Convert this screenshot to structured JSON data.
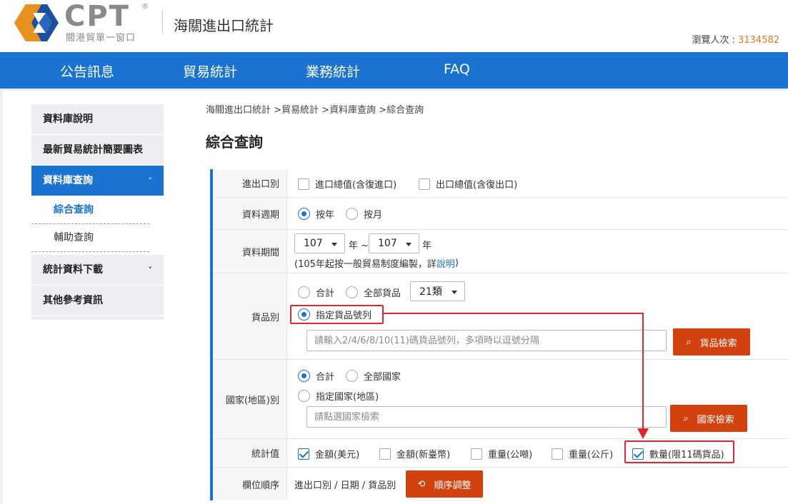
{
  "header": {
    "logo_text": "CPT",
    "logo_reg": "®",
    "logo_subtitle": "關港貿單一窗口",
    "site_title": "海關進出口統計",
    "visitor_label": "瀏覽人次 : ",
    "visitor_count": "3134582"
  },
  "nav": {
    "items": [
      "公告訊息",
      "貿易統計",
      "業務統計",
      "FAQ"
    ]
  },
  "sidebar": {
    "items": [
      {
        "label": "資料庫說明"
      },
      {
        "label": "最新貿易統計簡要圖表"
      },
      {
        "label": "資料庫查詢",
        "chevron": "˄"
      },
      {
        "label": "統計資料下載",
        "chevron": "˅"
      },
      {
        "label": "其他參考資訊"
      }
    ],
    "subitems": [
      "綜合查詢",
      "輔助查詢"
    ]
  },
  "breadcrumb": "海關進出口統計 >貿易統計 >資料庫查詢 >綜合查詢",
  "page_title": "綜合查詢",
  "form": {
    "import_export": {
      "label": "進出口別",
      "options": [
        "進口總值(含復進口)",
        "出口總值(含復出口)"
      ]
    },
    "period_type": {
      "label": "資料週期",
      "options": [
        "按年",
        "按月"
      ]
    },
    "period_range": {
      "label": "資料期間",
      "from_value": "107",
      "from_suffix": "年 ~",
      "to_value": "107",
      "to_suffix": "年",
      "note_prefix": "(105年起按一般貿易制度編製，詳",
      "note_link": "說明",
      "note_suffix": ")"
    },
    "goods": {
      "label": "貨品別",
      "option_total": "合計",
      "option_all": "全部貨品",
      "select_value": "21類",
      "option_specify": "指定貨品號列",
      "input_placeholder": "請輸入2/4/6/8/10(11)碼貨品號列，多項時以逗號分隔",
      "search_button": "貨品檢索"
    },
    "country": {
      "label": "國家(地區)別",
      "option_total": "合計",
      "option_all": "全部國家",
      "option_specify": "指定國家(地區)",
      "input_placeholder": "請點選國家檢索",
      "search_button": "國家檢索"
    },
    "stat_values": {
      "label": "統計值",
      "options": [
        "金額(美元)",
        "金額(新臺幣)",
        "重量(公噸)",
        "重量(公斤)",
        "數量(限11碼貨品)"
      ]
    },
    "column_order": {
      "label": "欄位順序",
      "value": "進出口別 / 日期 / 貨品別",
      "button": "順序調整"
    }
  }
}
